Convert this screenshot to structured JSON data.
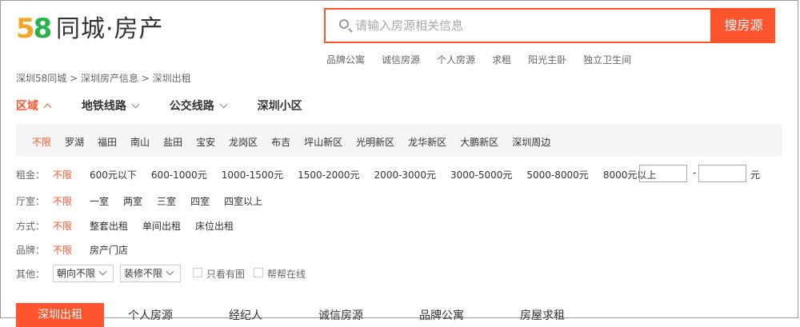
{
  "logo": {
    "digit5": "5",
    "digit8": "8",
    "text": "同城·房产"
  },
  "search": {
    "placeholder": "请输入房源相关信息",
    "button_label": "搜房源"
  },
  "hot_links": [
    "品牌公寓",
    "诚信房源",
    "个人房源",
    "求租",
    "阳光主卧",
    "独立卫生间"
  ],
  "breadcrumb": "深圳58同城 > 深圳房产信息 > 深圳出租",
  "tabs": [
    {
      "label": "区域"
    },
    {
      "label": "地铁线路"
    },
    {
      "label": "公交线路"
    },
    {
      "label": "深圳小区"
    }
  ],
  "districts": [
    "不限",
    "罗湖",
    "福田",
    "南山",
    "盐田",
    "宝安",
    "龙岗区",
    "布吉",
    "坪山新区",
    "光明新区",
    "龙华新区",
    "大鹏新区",
    "深圳周边"
  ],
  "filters": {
    "rent": {
      "label": "租金：",
      "options": [
        "不限",
        "600元以下",
        "600-1000元",
        "1000-1500元",
        "1500-2000元",
        "2000-3000元",
        "3000-5000元",
        "5000-8000元",
        "8000元以上"
      ],
      "dash": "-",
      "unit": "元"
    },
    "room": {
      "label": "厅室：",
      "options": [
        "不限",
        "一室",
        "两室",
        "三室",
        "四室",
        "四室以上"
      ]
    },
    "method": {
      "label": "方式：",
      "options": [
        "不限",
        "整套出租",
        "单间出租",
        "床位出租"
      ]
    },
    "brand": {
      "label": "品牌：",
      "options": [
        "不限",
        "房产门店"
      ]
    },
    "other": {
      "label": "其他：",
      "orientation_select": "朝向不限",
      "decoration_select": "装修不限",
      "checkbox_photos": "只看有图",
      "checkbox_online": "帮帮在线"
    }
  },
  "bottom_tabs": {
    "active": "深圳出租",
    "others": [
      "个人房源",
      "经纪人",
      "诚信房源",
      "品牌公寓",
      "房屋求租"
    ]
  },
  "colors": {
    "accent": "#ff552e",
    "logo_5": "#f5a623",
    "logo_8": "#28b34a"
  }
}
